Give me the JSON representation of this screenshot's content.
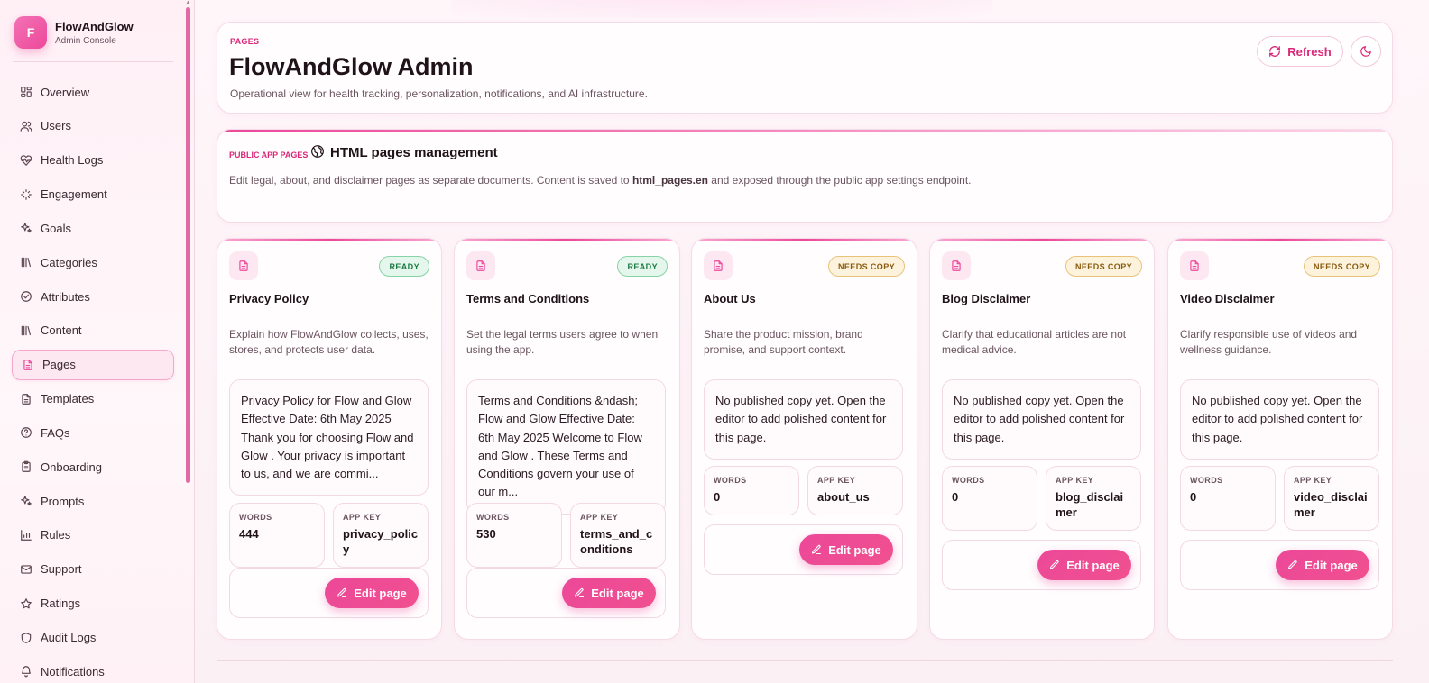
{
  "brand": {
    "logo_letter": "F",
    "name": "FlowAndGlow",
    "subtitle": "Admin Console"
  },
  "sidebar": {
    "items": [
      {
        "label": "Overview",
        "icon": "grid-icon"
      },
      {
        "label": "Users",
        "icon": "users-icon"
      },
      {
        "label": "Health Logs",
        "icon": "heart-pulse-icon"
      },
      {
        "label": "Engagement",
        "icon": "sparkles-icon"
      },
      {
        "label": "Goals",
        "icon": "sparkle-icon"
      },
      {
        "label": "Categories",
        "icon": "library-icon"
      },
      {
        "label": "Attributes",
        "icon": "check-circle-icon"
      },
      {
        "label": "Content",
        "icon": "library-icon"
      },
      {
        "label": "Pages",
        "icon": "document-icon",
        "active": true
      },
      {
        "label": "Templates",
        "icon": "document-icon"
      },
      {
        "label": "FAQs",
        "icon": "help-circle-icon"
      },
      {
        "label": "Onboarding",
        "icon": "clipboard-icon"
      },
      {
        "label": "Prompts",
        "icon": "sparkle-icon"
      },
      {
        "label": "Rules",
        "icon": "bar-chart-icon"
      },
      {
        "label": "Support",
        "icon": "mail-icon"
      },
      {
        "label": "Ratings",
        "icon": "star-icon"
      },
      {
        "label": "Audit Logs",
        "icon": "shield-icon"
      },
      {
        "label": "Notifications",
        "icon": "bell-icon"
      }
    ]
  },
  "header": {
    "eyebrow": "PAGES",
    "title": "FlowAndGlow Admin",
    "description": "Operational view for health tracking, personalization, notifications, and AI infrastructure.",
    "refresh_label": "Refresh"
  },
  "section": {
    "eyebrow": "PUBLIC APP PAGES",
    "title": "HTML pages management",
    "desc_before": "Edit legal, about, and disclaimer pages as separate documents. Content is saved to ",
    "desc_key": "html_pages.en",
    "desc_after": " and exposed through the public app settings endpoint."
  },
  "labels": {
    "words": "WORDS",
    "app_key": "APP KEY",
    "edit": "Edit page"
  },
  "pages": [
    {
      "status": "READY",
      "title": "Privacy Policy",
      "description": "Explain how FlowAndGlow collects, uses, stores, and protects user data.",
      "preview": "Privacy Policy for Flow and Glow Effective Date: 6th May 2025 Thank you for choosing Flow and Glow . Your privacy is important to us, and we are commi...",
      "words": "444",
      "app_key": "privacy_policy"
    },
    {
      "status": "READY",
      "title": "Terms and Conditions",
      "description": "Set the legal terms users agree to when using the app.",
      "preview": "Terms and Conditions &ndash; Flow and Glow Effective Date: 6th May 2025 Welcome to Flow and Glow . These Terms and Conditions govern your use of our m...",
      "words": "530",
      "app_key": "terms_and_conditions"
    },
    {
      "status": "NEEDS COPY",
      "title": "About Us",
      "description": "Share the product mission, brand promise, and support context.",
      "preview": "No published copy yet. Open the editor to add polished content for this page.",
      "words": "0",
      "app_key": "about_us"
    },
    {
      "status": "NEEDS COPY",
      "title": "Blog Disclaimer",
      "description": "Clarify that educational articles are not medical advice.",
      "preview": "No published copy yet. Open the editor to add polished content for this page.",
      "words": "0",
      "app_key": "blog_disclaimer"
    },
    {
      "status": "NEEDS COPY",
      "title": "Video Disclaimer",
      "description": "Clarify responsible use of videos and wellness guidance.",
      "preview": "No published copy yet. Open the editor to add polished content for this page.",
      "words": "0",
      "app_key": "video_disclaimer"
    }
  ]
}
